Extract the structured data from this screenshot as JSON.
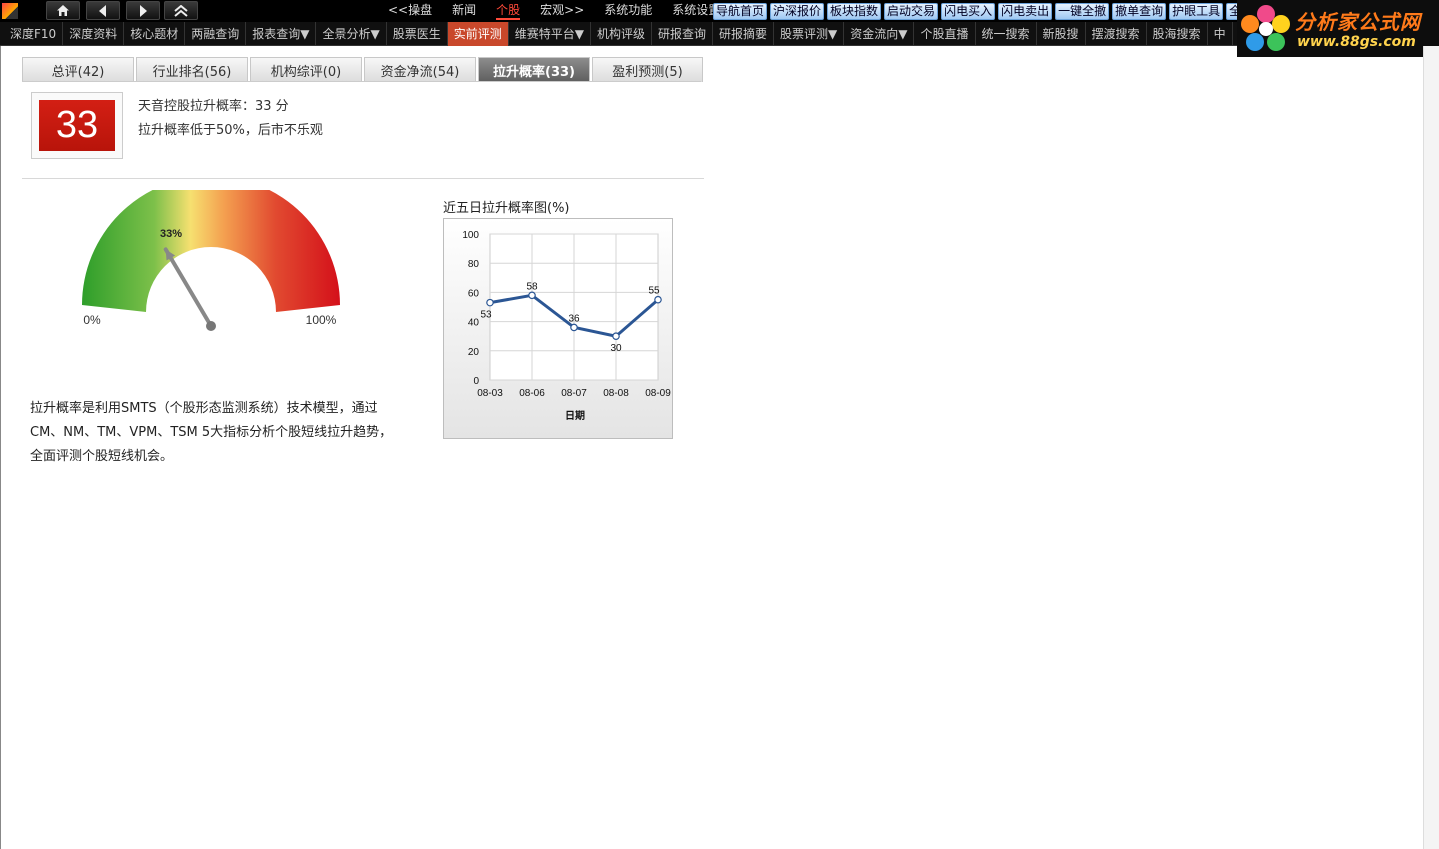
{
  "topbar": {
    "nav_icons": [
      "home-icon",
      "back-arrow-icon",
      "forward-arrow-icon",
      "collapse-up-icon"
    ],
    "menu": [
      {
        "label": "<<操盘",
        "active": false
      },
      {
        "label": "新闻",
        "active": false
      },
      {
        "label": "个股",
        "active": true
      },
      {
        "label": "宏观>>",
        "active": false
      },
      {
        "label": "系统功能",
        "active": false
      },
      {
        "label": "系统设置",
        "active": false
      }
    ],
    "quick_buttons": [
      "导航首页",
      "沪深报价",
      "板块指数",
      "启动交易",
      "闪电买入",
      "闪电卖出",
      "一键全撤",
      "撤单查询",
      "护眼工具",
      "全"
    ]
  },
  "secondary_menu": [
    {
      "label": "深度F10",
      "active": false
    },
    {
      "label": "深度资料",
      "active": false
    },
    {
      "label": "核心题材",
      "active": false
    },
    {
      "label": "两融查询",
      "active": false
    },
    {
      "label": "报表查询▼",
      "active": false
    },
    {
      "label": "全景分析▼",
      "active": false
    },
    {
      "label": "股票医生",
      "active": false
    },
    {
      "label": "实前评测",
      "active": true
    },
    {
      "label": "维赛特平台▼",
      "active": false
    },
    {
      "label": "机构评级",
      "active": false
    },
    {
      "label": "研报查询",
      "active": false
    },
    {
      "label": "研报摘要",
      "active": false
    },
    {
      "label": "股票评测▼",
      "active": false
    },
    {
      "label": "资金流向▼",
      "active": false
    },
    {
      "label": "个股直播",
      "active": false
    },
    {
      "label": "统一搜索",
      "active": false
    },
    {
      "label": "新股搜",
      "active": false
    },
    {
      "label": "摆渡搜索",
      "active": false
    },
    {
      "label": "股海搜索",
      "active": false
    },
    {
      "label": "中",
      "active": false
    }
  ],
  "brand": {
    "name": "分析家公式网",
    "url": "www.88gs.com"
  },
  "tabs": [
    {
      "label": "总评(42)",
      "active": false
    },
    {
      "label": "行业排名(56)",
      "active": false
    },
    {
      "label": "机构综评(0)",
      "active": false
    },
    {
      "label": "资金净流(54)",
      "active": false
    },
    {
      "label": "拉升概率(33)",
      "active": true
    },
    {
      "label": "盈利预测(5)",
      "active": false
    }
  ],
  "score": {
    "value": "33",
    "line1": "天音控股拉升概率：33 分",
    "line2": "拉升概率低于50%，后市不乐观"
  },
  "gauge": {
    "value": 33,
    "value_label": "33%",
    "min_label": "0%",
    "max_label": "100%"
  },
  "description": "拉升概率是利用SMTS（个股形态监测系统）技术模型，通过CM、NM、TM、VPM、TSM 5大指标分析个股短线拉升趋势，全面评测个股短线机会。",
  "chart_data": {
    "type": "line",
    "title": "近五日拉升概率图(%)",
    "xlabel": "日期",
    "ylabel": "",
    "categories": [
      "08-03",
      "08-06",
      "08-07",
      "08-08",
      "08-09"
    ],
    "values": [
      53,
      58,
      36,
      30,
      55
    ],
    "ylim": [
      0,
      100
    ],
    "yticks": [
      0,
      20,
      40,
      60,
      80,
      100
    ],
    "grid": true,
    "line_color": "#2b5694"
  }
}
